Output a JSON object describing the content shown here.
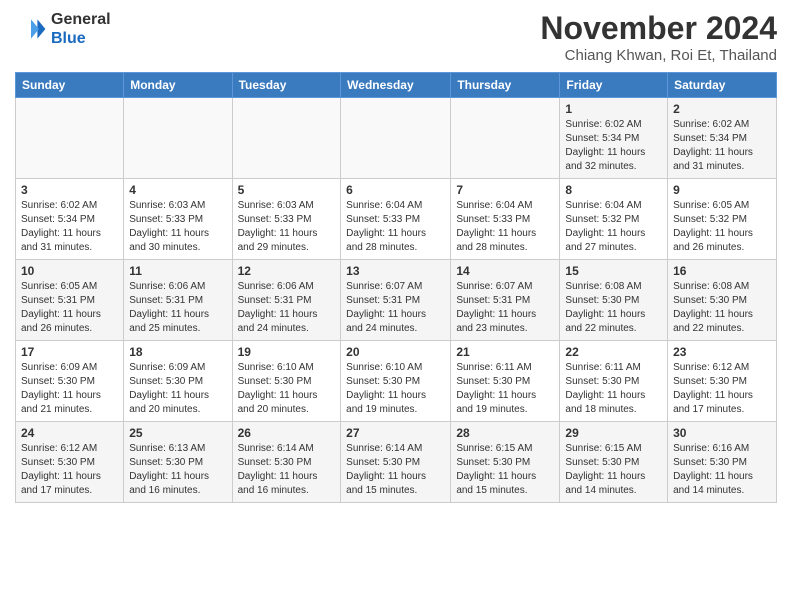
{
  "header": {
    "logo_line1": "General",
    "logo_line2": "Blue",
    "month": "November 2024",
    "location": "Chiang Khwan, Roi Et, Thailand"
  },
  "weekdays": [
    "Sunday",
    "Monday",
    "Tuesday",
    "Wednesday",
    "Thursday",
    "Friday",
    "Saturday"
  ],
  "weeks": [
    [
      {
        "day": "",
        "info": ""
      },
      {
        "day": "",
        "info": ""
      },
      {
        "day": "",
        "info": ""
      },
      {
        "day": "",
        "info": ""
      },
      {
        "day": "",
        "info": ""
      },
      {
        "day": "1",
        "info": "Sunrise: 6:02 AM\nSunset: 5:34 PM\nDaylight: 11 hours and 32 minutes."
      },
      {
        "day": "2",
        "info": "Sunrise: 6:02 AM\nSunset: 5:34 PM\nDaylight: 11 hours and 31 minutes."
      }
    ],
    [
      {
        "day": "3",
        "info": "Sunrise: 6:02 AM\nSunset: 5:34 PM\nDaylight: 11 hours and 31 minutes."
      },
      {
        "day": "4",
        "info": "Sunrise: 6:03 AM\nSunset: 5:33 PM\nDaylight: 11 hours and 30 minutes."
      },
      {
        "day": "5",
        "info": "Sunrise: 6:03 AM\nSunset: 5:33 PM\nDaylight: 11 hours and 29 minutes."
      },
      {
        "day": "6",
        "info": "Sunrise: 6:04 AM\nSunset: 5:33 PM\nDaylight: 11 hours and 28 minutes."
      },
      {
        "day": "7",
        "info": "Sunrise: 6:04 AM\nSunset: 5:33 PM\nDaylight: 11 hours and 28 minutes."
      },
      {
        "day": "8",
        "info": "Sunrise: 6:04 AM\nSunset: 5:32 PM\nDaylight: 11 hours and 27 minutes."
      },
      {
        "day": "9",
        "info": "Sunrise: 6:05 AM\nSunset: 5:32 PM\nDaylight: 11 hours and 26 minutes."
      }
    ],
    [
      {
        "day": "10",
        "info": "Sunrise: 6:05 AM\nSunset: 5:31 PM\nDaylight: 11 hours and 26 minutes."
      },
      {
        "day": "11",
        "info": "Sunrise: 6:06 AM\nSunset: 5:31 PM\nDaylight: 11 hours and 25 minutes."
      },
      {
        "day": "12",
        "info": "Sunrise: 6:06 AM\nSunset: 5:31 PM\nDaylight: 11 hours and 24 minutes."
      },
      {
        "day": "13",
        "info": "Sunrise: 6:07 AM\nSunset: 5:31 PM\nDaylight: 11 hours and 24 minutes."
      },
      {
        "day": "14",
        "info": "Sunrise: 6:07 AM\nSunset: 5:31 PM\nDaylight: 11 hours and 23 minutes."
      },
      {
        "day": "15",
        "info": "Sunrise: 6:08 AM\nSunset: 5:30 PM\nDaylight: 11 hours and 22 minutes."
      },
      {
        "day": "16",
        "info": "Sunrise: 6:08 AM\nSunset: 5:30 PM\nDaylight: 11 hours and 22 minutes."
      }
    ],
    [
      {
        "day": "17",
        "info": "Sunrise: 6:09 AM\nSunset: 5:30 PM\nDaylight: 11 hours and 21 minutes."
      },
      {
        "day": "18",
        "info": "Sunrise: 6:09 AM\nSunset: 5:30 PM\nDaylight: 11 hours and 20 minutes."
      },
      {
        "day": "19",
        "info": "Sunrise: 6:10 AM\nSunset: 5:30 PM\nDaylight: 11 hours and 20 minutes."
      },
      {
        "day": "20",
        "info": "Sunrise: 6:10 AM\nSunset: 5:30 PM\nDaylight: 11 hours and 19 minutes."
      },
      {
        "day": "21",
        "info": "Sunrise: 6:11 AM\nSunset: 5:30 PM\nDaylight: 11 hours and 19 minutes."
      },
      {
        "day": "22",
        "info": "Sunrise: 6:11 AM\nSunset: 5:30 PM\nDaylight: 11 hours and 18 minutes."
      },
      {
        "day": "23",
        "info": "Sunrise: 6:12 AM\nSunset: 5:30 PM\nDaylight: 11 hours and 17 minutes."
      }
    ],
    [
      {
        "day": "24",
        "info": "Sunrise: 6:12 AM\nSunset: 5:30 PM\nDaylight: 11 hours and 17 minutes."
      },
      {
        "day": "25",
        "info": "Sunrise: 6:13 AM\nSunset: 5:30 PM\nDaylight: 11 hours and 16 minutes."
      },
      {
        "day": "26",
        "info": "Sunrise: 6:14 AM\nSunset: 5:30 PM\nDaylight: 11 hours and 16 minutes."
      },
      {
        "day": "27",
        "info": "Sunrise: 6:14 AM\nSunset: 5:30 PM\nDaylight: 11 hours and 15 minutes."
      },
      {
        "day": "28",
        "info": "Sunrise: 6:15 AM\nSunset: 5:30 PM\nDaylight: 11 hours and 15 minutes."
      },
      {
        "day": "29",
        "info": "Sunrise: 6:15 AM\nSunset: 5:30 PM\nDaylight: 11 hours and 14 minutes."
      },
      {
        "day": "30",
        "info": "Sunrise: 6:16 AM\nSunset: 5:30 PM\nDaylight: 11 hours and 14 minutes."
      }
    ]
  ]
}
